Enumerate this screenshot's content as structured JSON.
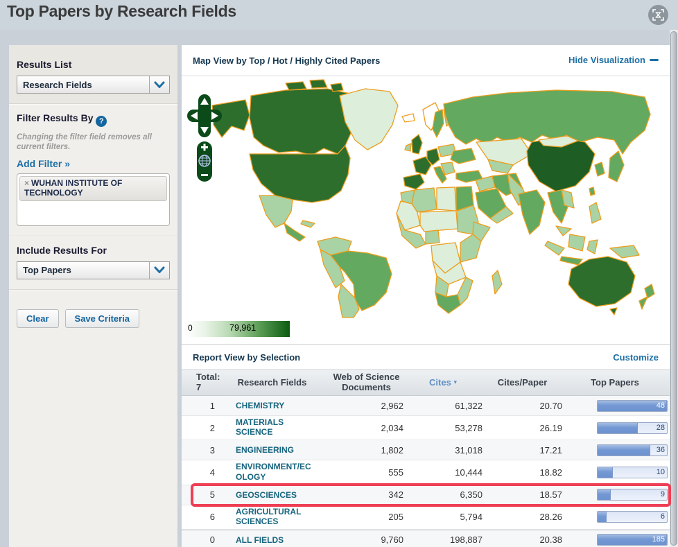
{
  "header": {
    "title": "Top Papers by Research Fields"
  },
  "sidebar": {
    "results_list": {
      "label": "Results List",
      "selected": "Research Fields"
    },
    "filter": {
      "label": "Filter Results By",
      "note": "Changing the filter field removes all current filters.",
      "add_filter_label": "Add Filter »",
      "active_filters": [
        {
          "remove_icon": "×",
          "label": "WUHAN INSTITUTE OF TECHNOLOGY"
        }
      ]
    },
    "include_results": {
      "label": "Include Results For",
      "selected": "Top Papers"
    },
    "buttons": {
      "clear": "Clear",
      "save": "Save Criteria"
    }
  },
  "map_section": {
    "title": "Map View by Top / Hot / Highly Cited Papers",
    "hide_link": "Hide Visualization",
    "legend": {
      "min": "0",
      "max_label": "79,961"
    },
    "palette": {
      "none": "#ffffff",
      "verylight": "#ddeeda",
      "light": "#a9d3a4",
      "medium": "#63a95f",
      "dark": "#2d6e2d",
      "darkest": "#1e5e24",
      "stroke": "#ec9e1e"
    }
  },
  "report": {
    "title": "Report View by Selection",
    "customize_link": "Customize",
    "columns": {
      "total": "Total:",
      "total_count": "7",
      "field": "Research Fields",
      "docs": "Web of Science Documents",
      "cites": "Cites",
      "cites_sort_icon": "▾",
      "cites_paper": "Cites/Paper",
      "top_papers": "Top Papers"
    },
    "highlight_color": "#ee3f55",
    "rows": [
      {
        "rank": "1",
        "field": "CHEMISTRY",
        "docs": "2,962",
        "cites": "61,322",
        "cites_per_paper": "20.70",
        "top_papers": "48",
        "bar_pct": 100,
        "highlighted": false,
        "is_total": false
      },
      {
        "rank": "2",
        "field": "MATERIALS SCIENCE",
        "docs": "2,034",
        "cites": "53,278",
        "cites_per_paper": "26.19",
        "top_papers": "28",
        "bar_pct": 58,
        "highlighted": false,
        "is_total": false
      },
      {
        "rank": "3",
        "field": "ENGINEERING",
        "docs": "1,802",
        "cites": "31,018",
        "cites_per_paper": "17.21",
        "top_papers": "36",
        "bar_pct": 76,
        "highlighted": false,
        "is_total": false
      },
      {
        "rank": "4",
        "field": "ENVIRONMENT/ECOLOGY",
        "docs": "555",
        "cites": "10,444",
        "cites_per_paper": "18.82",
        "top_papers": "10",
        "bar_pct": 22,
        "highlighted": false,
        "is_total": false
      },
      {
        "rank": "5",
        "field": "GEOSCIENCES",
        "docs": "342",
        "cites": "6,350",
        "cites_per_paper": "18.57",
        "top_papers": "9",
        "bar_pct": 19,
        "highlighted": true,
        "is_total": false
      },
      {
        "rank": "6",
        "field": "AGRICULTURAL SCIENCES",
        "docs": "205",
        "cites": "5,794",
        "cites_per_paper": "28.26",
        "top_papers": "6",
        "bar_pct": 13,
        "highlighted": false,
        "is_total": false
      },
      {
        "rank": "0",
        "field": "ALL FIELDS",
        "docs": "9,760",
        "cites": "198,887",
        "cites_per_paper": "20.38",
        "top_papers": "185",
        "bar_pct": 100,
        "highlighted": false,
        "is_total": true
      }
    ]
  }
}
